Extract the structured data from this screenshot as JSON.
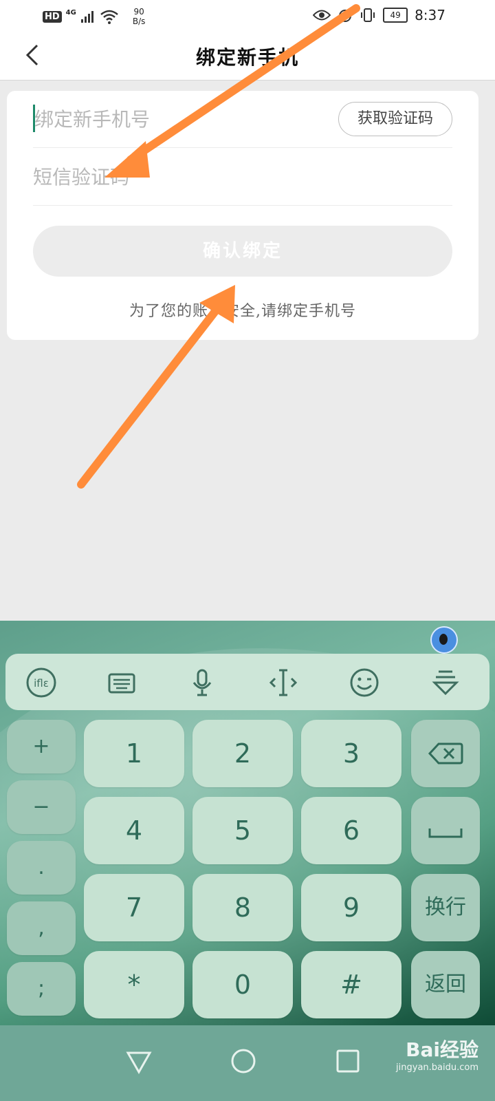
{
  "status_bar": {
    "hd_badge": "HD",
    "network": "4G",
    "speed_value": "90",
    "speed_unit": "B/s",
    "battery": "49",
    "time": "8:37"
  },
  "header": {
    "title": "绑定新手机"
  },
  "form": {
    "phone_placeholder": "绑定新手机号",
    "get_code_label": "获取验证码",
    "sms_placeholder": "短信验证码",
    "confirm_label": "确认绑定",
    "hint": "为了您的账户安全,请绑定手机号"
  },
  "colors": {
    "accent": "#1e8a6a",
    "annotation_arrow": "#ff8c3a",
    "keyboard": "#6aa894"
  },
  "keyboard": {
    "toolbar_icons": [
      "iflytek-logo-icon",
      "keyboard-icon",
      "microphone-icon",
      "cursor-icon",
      "emoji-icon",
      "collapse-keyboard-icon"
    ],
    "side_keys": [
      "+",
      "−",
      ".",
      ",",
      ";"
    ],
    "grid_keys": [
      [
        "1",
        "2",
        "3"
      ],
      [
        "4",
        "5",
        "6"
      ],
      [
        "7",
        "8",
        "9"
      ],
      [
        "*",
        "0",
        "#"
      ]
    ],
    "fn_keys": {
      "delete": "backspace-icon",
      "space": "space-icon",
      "newline": "换行",
      "back": "返回"
    }
  },
  "watermark": {
    "brand": "Bai经验",
    "url": "jingyan.baidu.com"
  }
}
